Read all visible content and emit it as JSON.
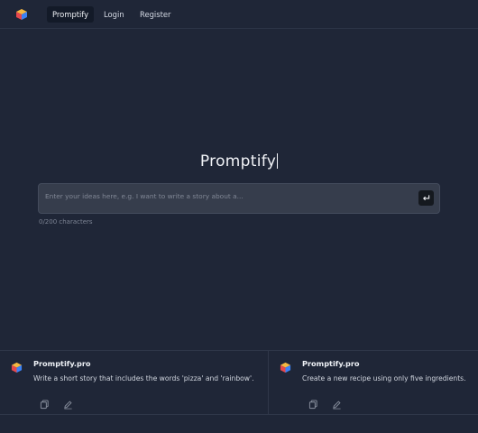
{
  "nav": {
    "items": [
      {
        "label": "Promptify",
        "active": true
      },
      {
        "label": "Login",
        "active": false
      },
      {
        "label": "Register",
        "active": false
      }
    ],
    "logo_icon": "cube-logo-icon"
  },
  "hero": {
    "title": "Promptify",
    "placeholder": "Enter your ideas here, e.g. I want to write a story about a...",
    "char_count": "0/200 characters",
    "submit_icon": "enter-return-icon"
  },
  "cards": [
    {
      "site": "Promptify.pro",
      "text": "Write a short story that includes the words 'pizza' and 'rainbow'.",
      "actions": [
        "copy-icon",
        "edit-icon"
      ]
    },
    {
      "site": "Promptify.pro",
      "text": "Create a new recipe using only five ingredients.",
      "actions": [
        "copy-icon",
        "edit-icon"
      ]
    }
  ],
  "colors": {
    "background": "#1f2637",
    "input_bg": "#363d4c",
    "cube_red": "#e5484d",
    "cube_blue": "#3b82f6",
    "cube_yellow": "#f5b841"
  }
}
